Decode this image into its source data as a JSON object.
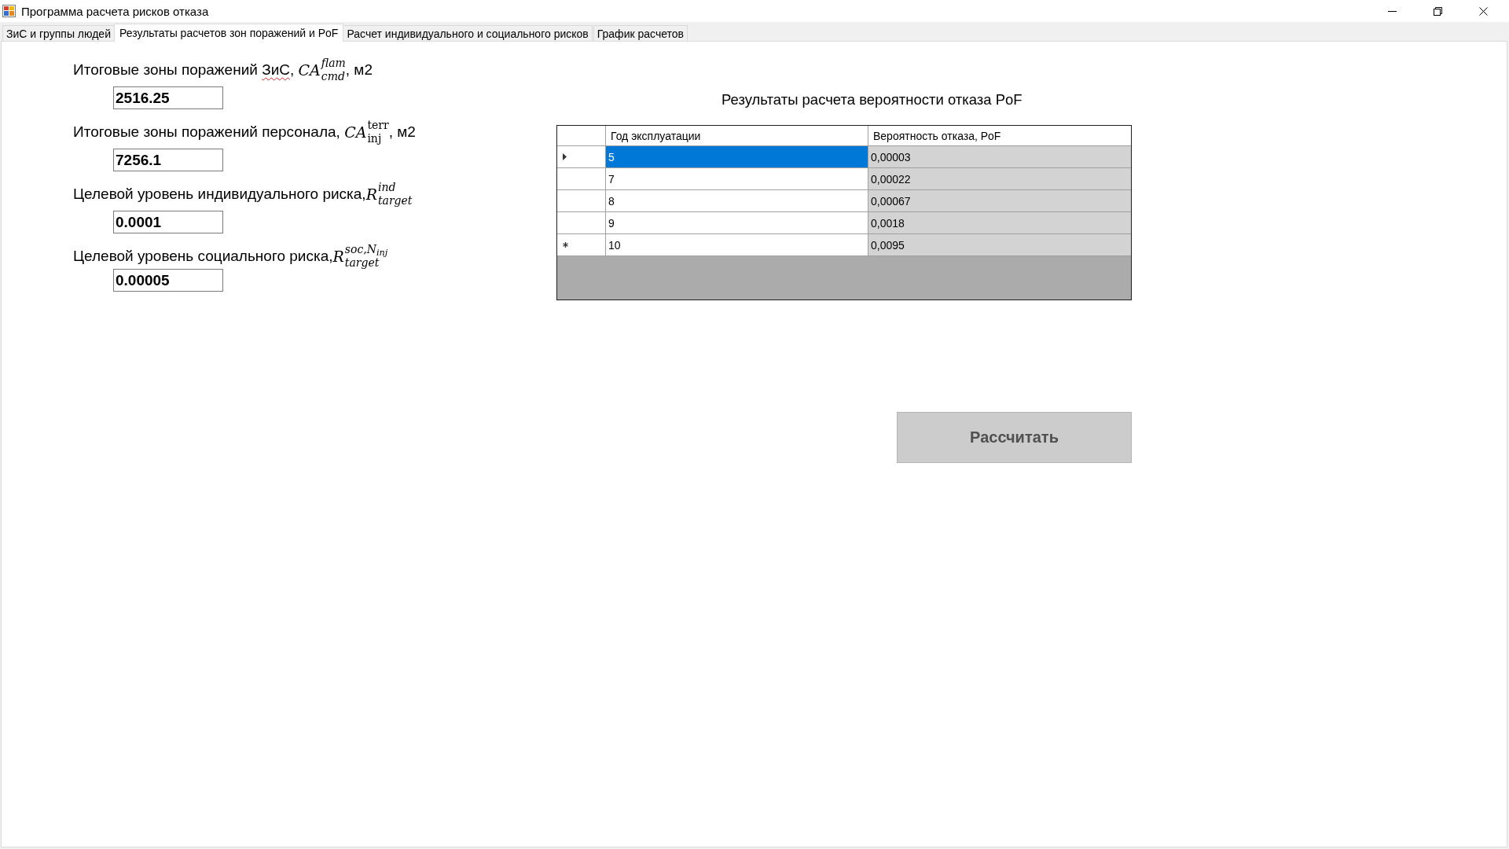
{
  "window": {
    "title": "Программа расчета рисков отказа"
  },
  "tabs": [
    {
      "label": "ЗиС и группы людей",
      "selected": false
    },
    {
      "label": "Результаты расчетов зон поражений и PoF",
      "selected": true
    },
    {
      "label": "Расчет индивидуального и социального рисков",
      "selected": false
    },
    {
      "label": "График расчетов",
      "selected": false
    }
  ],
  "inputs": [
    {
      "label": [
        {
          "kind": "text",
          "text": "Итоговые зоны поражений "
        },
        {
          "kind": "misspelled",
          "text": "ЗиС"
        },
        {
          "kind": "text",
          "text": ", "
        },
        {
          "kind": "math",
          "base": "CA",
          "sup": "flam",
          "sub": "cmd",
          "upright_scripts": false
        },
        {
          "kind": "text",
          "text": ", м2"
        }
      ],
      "value": "2516.25"
    },
    {
      "label": [
        {
          "kind": "text",
          "text": "Итоговые зоны поражений персонала, "
        },
        {
          "kind": "math",
          "base": "CA",
          "sup": "terr",
          "sub": "inj",
          "upright_scripts": true
        },
        {
          "kind": "text",
          "text": ", м2"
        }
      ],
      "value": "7256.1"
    },
    {
      "label": [
        {
          "kind": "text",
          "text": "Целевой уровень индивидуального риска,"
        },
        {
          "kind": "math",
          "base": "R",
          "sup": "ind",
          "sub": "target",
          "upright_scripts": false
        }
      ],
      "value": "0.0001"
    },
    {
      "label": [
        {
          "kind": "text",
          "text": "Целевой уровень социального риска,"
        },
        {
          "kind": "math",
          "base": "R",
          "sup": "soc,N$_{inj}$",
          "sub": "target",
          "upright_scripts": false
        }
      ],
      "value": "0.00005"
    }
  ],
  "results": {
    "title": "Результаты расчета вероятности отказа PoF",
    "columns": [
      {
        "label": "Год эксплуатации",
        "read_only": false
      },
      {
        "label": "Вероятность отказа, PoF",
        "read_only": true
      }
    ],
    "rows": [
      {
        "kind": "current",
        "cells": [
          {
            "text": "5",
            "selected": true
          },
          {
            "text": "0,00003",
            "selected": false
          }
        ]
      },
      {
        "kind": "plain",
        "cells": [
          {
            "text": "7",
            "selected": false
          },
          {
            "text": "0,00022",
            "selected": false
          }
        ]
      },
      {
        "kind": "plain",
        "cells": [
          {
            "text": "8",
            "selected": false
          },
          {
            "text": "0,00067",
            "selected": false
          }
        ]
      },
      {
        "kind": "plain",
        "cells": [
          {
            "text": "9",
            "selected": false
          },
          {
            "text": "0,0018",
            "selected": false
          }
        ]
      },
      {
        "kind": "new",
        "cells": [
          {
            "text": "10",
            "selected": false
          },
          {
            "text": "0,0095",
            "selected": false
          }
        ]
      }
    ]
  },
  "calculate_button": {
    "label": "Рассчитать"
  }
}
